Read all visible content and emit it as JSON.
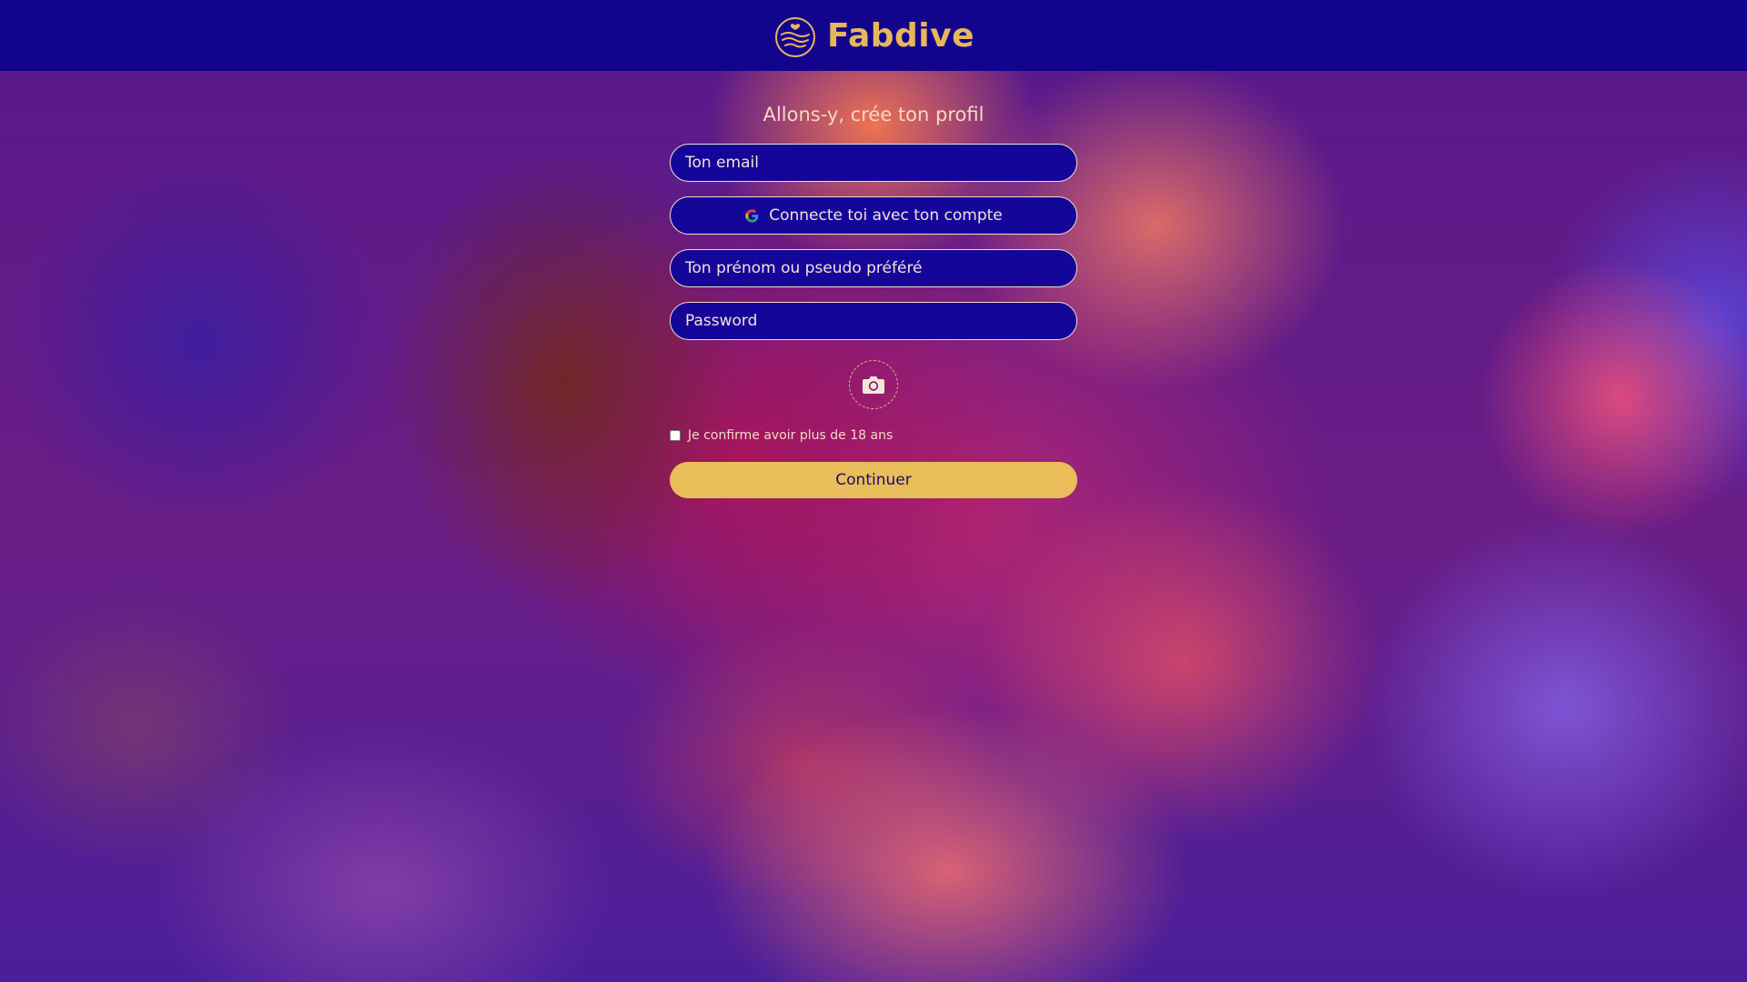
{
  "header": {
    "brand": "Fabdive",
    "logo_icon": "wave-heart-logo-icon"
  },
  "form": {
    "title": "Allons-y, crée ton profil",
    "email_placeholder": "Ton email",
    "google_label": "Connecte toi avec ton compte",
    "google_icon": "google-icon",
    "name_placeholder": "Ton prénom ou pseudo préféré",
    "password_placeholder": "Password",
    "photo_icon": "camera-icon",
    "age_label": "Je confirme avoir plus de 18 ans",
    "age_checked": false,
    "continue_label": "Continuer"
  },
  "colors": {
    "header_bg": "#13048e",
    "brand": "#e8b65c",
    "field_bg": "#15069a",
    "field_border": "#f0dcc9",
    "button_bg": "#e8bd5a",
    "button_text": "#1e0b6e"
  }
}
